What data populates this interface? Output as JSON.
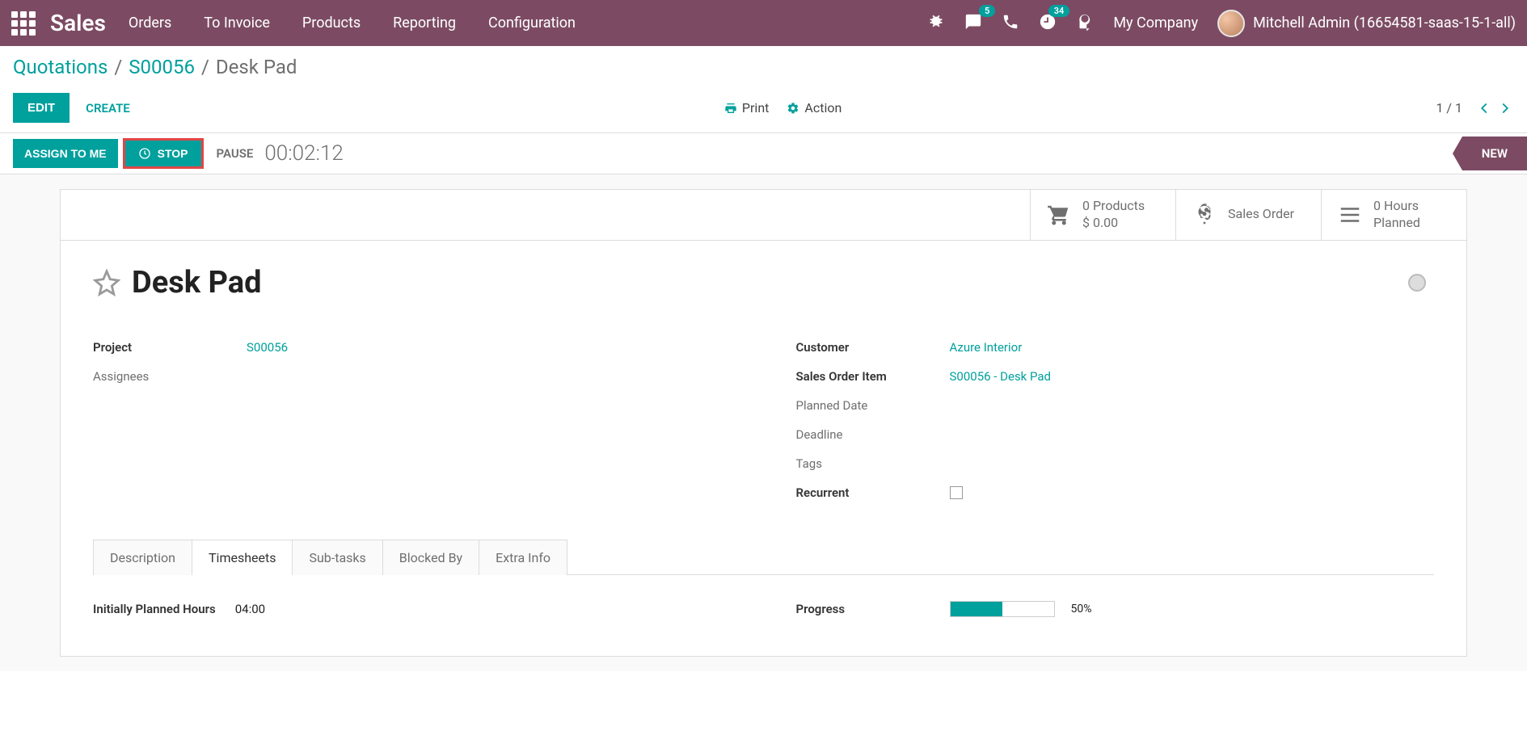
{
  "nav": {
    "app": "Sales",
    "menu": [
      "Orders",
      "To Invoice",
      "Products",
      "Reporting",
      "Configuration"
    ],
    "messaging_badge": "5",
    "activities_badge": "34",
    "company": "My Company",
    "user": "Mitchell Admin (16654581-saas-15-1-all)"
  },
  "breadcrumb": {
    "root": "Quotations",
    "parent": "S00056",
    "current": "Desk Pad"
  },
  "buttons": {
    "edit": "EDIT",
    "create": "CREATE",
    "print": "Print",
    "action": "Action"
  },
  "pager": {
    "text": "1 / 1"
  },
  "status": {
    "assign": "ASSIGN TO ME",
    "stop": "STOP",
    "pause": "PAUSE",
    "timer": "00:02:12",
    "stage_new": "NEW"
  },
  "stats": {
    "products": {
      "line1": "0 Products",
      "line2": "$ 0.00"
    },
    "sales_order": {
      "line1": "",
      "line2": "Sales Order"
    },
    "hours": {
      "line1": "0  Hours",
      "line2": "Planned"
    }
  },
  "record": {
    "title": "Desk Pad",
    "left_fields": [
      {
        "label": "Project",
        "muted": false,
        "value": "S00056",
        "link": true
      },
      {
        "label": "Assignees",
        "muted": true,
        "value": "",
        "link": false
      }
    ],
    "right_fields": [
      {
        "label": "Customer",
        "muted": false,
        "value": "Azure Interior",
        "link": true
      },
      {
        "label": "Sales Order Item",
        "muted": false,
        "value": "S00056 - Desk Pad",
        "link": true
      },
      {
        "label": "Planned Date",
        "muted": true,
        "value": "",
        "link": false
      },
      {
        "label": "Deadline",
        "muted": true,
        "value": "",
        "link": false
      },
      {
        "label": "Tags",
        "muted": true,
        "value": "",
        "link": false
      }
    ],
    "recurrent_label": "Recurrent"
  },
  "tabs": {
    "items": [
      "Description",
      "Timesheets",
      "Sub-tasks",
      "Blocked By",
      "Extra Info"
    ],
    "active": "Timesheets"
  },
  "timesheets": {
    "planned_label": "Initially Planned Hours",
    "planned_value": "04:00",
    "progress_label": "Progress",
    "progress_pct_label": "50%",
    "progress_pct": 50
  }
}
